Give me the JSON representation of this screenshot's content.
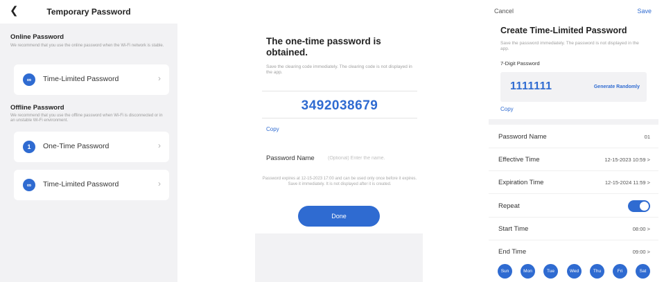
{
  "panel1": {
    "title": "Temporary Password",
    "online": {
      "title": "Online Password",
      "desc": "We recommend that you use the online password when the Wi-Fi network is stable."
    },
    "online_items": [
      {
        "badge": "∞",
        "label": "Time-Limited Password"
      }
    ],
    "offline": {
      "title": "Offline Password",
      "desc": "We recommend that you use the offline password when Wi-Fi is disconnected or in an unstable Wi-Fi environment."
    },
    "offline_items": [
      {
        "badge": "1",
        "label": "One-Time Password"
      },
      {
        "badge": "∞",
        "label": "Time-Limited Password"
      }
    ]
  },
  "panel2": {
    "title": "The one-time password is obtained.",
    "desc": "Save the clearing code immediately. The clearing code is not displayed in the app.",
    "code": "3492038679",
    "copy": "Copy",
    "name_label": "Password Name",
    "name_placeholder": "(Optional) Enter the name.",
    "expire_note": "Password expires at 12-15-2023 17:00 and can be used only once before it expires. Save it immediately. It is not displayed after it is created.",
    "done": "Done"
  },
  "panel3": {
    "cancel": "Cancel",
    "save": "Save",
    "title": "Create Time-Limited Password",
    "desc": "Save the password immediately. The password is not displayed in the app.",
    "digit_label": "7-Digit Password",
    "password": "1111111",
    "generate": "Generate Randomly",
    "copy": "Copy",
    "rows": [
      {
        "label": "Password Name",
        "value": "01"
      },
      {
        "label": "Effective Time",
        "value": "12-15-2023 10:59 >"
      },
      {
        "label": "Expiration Time",
        "value": "12-15-2024 11:59 >"
      }
    ],
    "repeat_label": "Repeat",
    "repeat_on": true,
    "time_rows": [
      {
        "label": "Start Time",
        "value": "08:00 >"
      },
      {
        "label": "End Time",
        "value": "09:00 >"
      }
    ],
    "days": [
      "Sun",
      "Mon",
      "Tue",
      "Wed",
      "Thu",
      "Fri",
      "Sat"
    ]
  },
  "colors": {
    "accent": "#2f6bd1",
    "background": "#f2f2f4"
  }
}
